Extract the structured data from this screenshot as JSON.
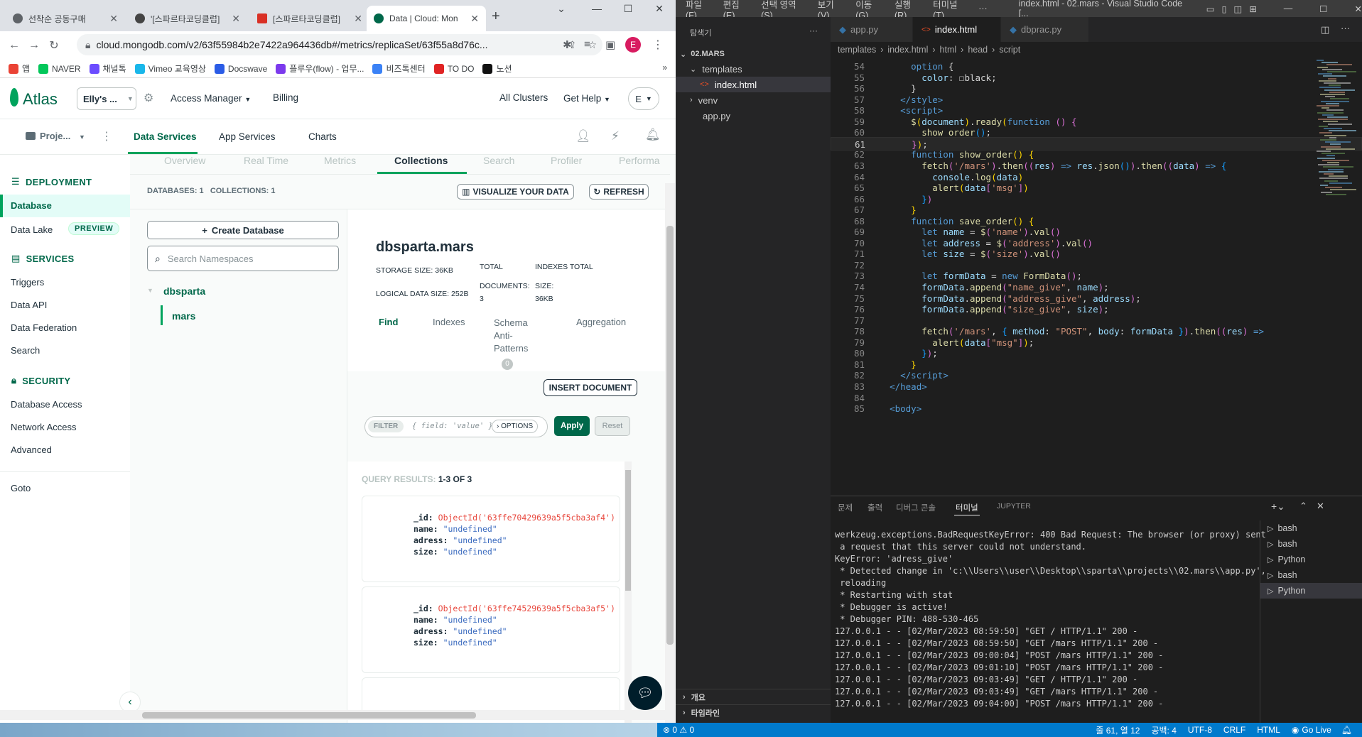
{
  "chrome": {
    "tabs": [
      {
        "title": "선착순 공동구매",
        "icon_color": "#5f6368"
      },
      {
        "title": "'[스파르타코딩클럽]",
        "icon_color": "#444444"
      },
      {
        "title": "[스파르타코딩클럽]",
        "icon_color": "#d93025"
      },
      {
        "title": "Data | Cloud: Mon",
        "icon_color": "#00684a"
      }
    ],
    "new_tab": "+",
    "window_controls": [
      "⌄",
      "—",
      "☐",
      "✕"
    ],
    "url": "cloud.mongodb.com/v2/63f55984b2e7422a964436db#/metrics/replicaSet/63f55a8d76c...",
    "profile_initial": "E",
    "bookmarks": [
      {
        "label": "앱",
        "color": "#ea4335"
      },
      {
        "label": "NAVER",
        "color": "#03c75a"
      },
      {
        "label": "채널톡",
        "color": "#6c4cff"
      },
      {
        "label": "Vimeo 교육영상",
        "color": "#1ab7ea"
      },
      {
        "label": "Docswave",
        "color": "#2b5ce6"
      },
      {
        "label": "플루우(flow) - 업무...",
        "color": "#7c3aed"
      },
      {
        "label": "비즈톡센터",
        "color": "#3b82f6"
      },
      {
        "label": "TO DO",
        "color": "#e02424"
      },
      {
        "label": "노션",
        "color": "#111111"
      }
    ],
    "bookmarks_more": "»"
  },
  "atlas": {
    "logo": "Atlas",
    "org": "Elly's ...",
    "access_manager": "Access Manager",
    "billing": "Billing",
    "all_clusters": "All Clusters",
    "get_help": "Get Help",
    "user_initial": "E",
    "project": "Proje...",
    "nav": [
      "Data Services",
      "App Services",
      "Charts"
    ],
    "subtabs": [
      "Overview",
      "Real Time",
      "Metrics",
      "Collections",
      "Search",
      "Profiler",
      "Performa"
    ],
    "sidebar": {
      "deployment_header": "DEPLOYMENT",
      "database": "Database",
      "data_lake": "Data Lake",
      "preview_badge": "PREVIEW",
      "services_header": "SERVICES",
      "services": [
        "Triggers",
        "Data API",
        "Data Federation",
        "Search"
      ],
      "security_header": "SECURITY",
      "security": [
        "Database Access",
        "Network Access",
        "Advanced"
      ],
      "goto": "Goto"
    },
    "counts": "DATABASES: 1   COLLECTIONS: 1",
    "visualize_btn": "VISUALIZE YOUR DATA",
    "refresh_btn": "REFRESH",
    "create_db_btn": "Create Database",
    "search_placeholder": "Search Namespaces",
    "db_name": "dbsparta",
    "coll_name": "mars",
    "namespace_title": "dbsparta.mars",
    "storage_size": "STORAGE SIZE: 36KB",
    "logical_size": "LOGICAL DATA SIZE: 252B",
    "total_docs_label1": "TOTAL",
    "total_docs_label2": "DOCUMENTS:",
    "total_docs_value": "3",
    "indexes_label1": "INDEXES TOTAL",
    "indexes_label2": "SIZE:",
    "indexes_value": "36KB",
    "coll_tabs": [
      "Find",
      "Indexes",
      "Schema",
      "Anti-",
      "Patterns",
      "Aggregation"
    ],
    "schema_badge": "0",
    "insert_btn": "INSERT DOCUMENT",
    "filter_label": "FILTER",
    "filter_placeholder": "{ field: 'value' }",
    "options_btn": "› OPTIONS",
    "apply_btn": "Apply",
    "reset_btn": "Reset",
    "query_results_label": "QUERY RESULTS:",
    "query_results_value": "1-3 OF 3",
    "documents": [
      {
        "id_key": "_id:",
        "id": "ObjectId('63ffe70429639a5f5cba3af4')",
        "name_key": "name:",
        "name": "\"undefined\"",
        "adress_key": "adress:",
        "adress": "\"undefined\"",
        "size_key": "size:",
        "size": "\"undefined\""
      },
      {
        "id_key": "_id:",
        "id": "ObjectId('63ffe74529639a5f5cba3af5')",
        "name_key": "name:",
        "name": "\"undefined\"",
        "adress_key": "adress:",
        "adress": "\"undefined\"",
        "size_key": "size:",
        "size": "\"undefined\""
      }
    ]
  },
  "vscode": {
    "menu": [
      "파일(F)",
      "편집(E)",
      "선택 영역(S)",
      "보기(V)",
      "이동(G)",
      "실행(R)",
      "터미널(T)",
      "···"
    ],
    "title": "index.html - 02.mars - Visual Studio Code [...",
    "explorer_header": "탐색기",
    "explorer_more": "···",
    "root": "02.MARS",
    "tree": [
      "templates",
      "index.html",
      "venv",
      "app.py"
    ],
    "outline": "개요",
    "timeline": "타임라인",
    "tabs": [
      "app.py",
      "index.html",
      "dbprac.py"
    ],
    "breadcrumbs": [
      "templates",
      "›",
      "index.html",
      "›",
      "html",
      "›",
      "head",
      "›",
      "script"
    ],
    "current_line": 61,
    "code_lines": [
      {
        "n": 54,
        "html": "      <span class='tg'>option</span> <span class='pl'>{</span>"
      },
      {
        "n": 55,
        "html": "        <span class='vr'>color</span><span class='pl'>: </span><span class='pl'>☐black;</span>"
      },
      {
        "n": 56,
        "html": "      <span class='pl'>}</span>"
      },
      {
        "n": 57,
        "html": "    <span class='tg'>&lt;/style&gt;</span>"
      },
      {
        "n": 58,
        "html": "    <span class='tg'>&lt;script&gt;</span>"
      },
      {
        "n": 59,
        "html": "      <span class='fn'>$</span><span class='br'>(</span><span class='vr'>document</span><span class='br'>)</span>.<span class='fn'>ready</span><span class='br'>(</span><span class='kw'>function</span> <span class='br2'>()</span> <span class='br2'>{</span>"
      },
      {
        "n": 60,
        "html": "        <span class='fn'>show_order</span><span class='br3'>()</span>;"
      },
      {
        "n": 61,
        "html": "      <span class='br2'>}</span><span class='br'>)</span>;"
      },
      {
        "n": 62,
        "html": "      <span class='kw'>function</span> <span class='fn'>show_order</span><span class='br'>()</span> <span class='br'>{</span>"
      },
      {
        "n": 63,
        "html": "        <span class='fn'>fetch</span><span class='br2'>(</span><span class='st'>'/mars'</span><span class='br2'>)</span>.<span class='fn'>then</span><span class='br2'>((</span><span class='vr'>res</span><span class='br2'>)</span> <span class='kw'>=&gt;</span> <span class='vr'>res</span>.<span class='fn'>json</span><span class='br3'>()</span><span class='br2'>)</span>.<span class='fn'>then</span><span class='br2'>((</span><span class='vr'>data</span><span class='br2'>)</span> <span class='kw'>=&gt;</span> <span class='br3'>{</span>"
      },
      {
        "n": 64,
        "html": "          <span class='vr'>console</span>.<span class='fn'>log</span><span class='br'>(</span><span class='vr'>data</span><span class='br'>)</span>"
      },
      {
        "n": 65,
        "html": "          <span class='fn'>alert</span><span class='br'>(</span><span class='vr'>data</span><span class='br2'>[</span><span class='st'>'msg'</span><span class='br2'>]</span><span class='br'>)</span>"
      },
      {
        "n": 66,
        "html": "        <span class='br3'>}</span><span class='br2'>)</span>"
      },
      {
        "n": 67,
        "html": "      <span class='br'>}</span>"
      },
      {
        "n": 68,
        "html": "      <span class='kw'>function</span> <span class='fn'>save_order</span><span class='br'>()</span> <span class='br'>{</span>"
      },
      {
        "n": 69,
        "html": "        <span class='kw'>let</span> <span class='vr'>name</span> = <span class='fn'>$</span><span class='br2'>(</span><span class='st'>'name'</span><span class='br2'>)</span>.<span class='fn'>val</span><span class='br2'>()</span>"
      },
      {
        "n": 70,
        "html": "        <span class='kw'>let</span> <span class='vr'>address</span> = <span class='fn'>$</span><span class='br2'>(</span><span class='st'>'address'</span><span class='br2'>)</span>.<span class='fn'>val</span><span class='br2'>()</span>"
      },
      {
        "n": 71,
        "html": "        <span class='kw'>let</span> <span class='vr'>size</span> = <span class='fn'>$</span><span class='br2'>(</span><span class='st'>'size'</span><span class='br2'>)</span>.<span class='fn'>val</span><span class='br2'>()</span>"
      },
      {
        "n": 72,
        "html": ""
      },
      {
        "n": 73,
        "html": "        <span class='kw'>let</span> <span class='vr'>formData</span> = <span class='kw'>new</span> <span class='fn'>FormData</span><span class='br2'>()</span>;"
      },
      {
        "n": 74,
        "html": "        <span class='vr'>formData</span>.<span class='fn'>append</span><span class='br2'>(</span><span class='st'>\"name_give\"</span>, <span class='vr'>name</span><span class='br2'>)</span>;"
      },
      {
        "n": 75,
        "html": "        <span class='vr'>formData</span>.<span class='fn'>append</span><span class='br2'>(</span><span class='st'>\"address_give\"</span>, <span class='vr'>address</span><span class='br2'>)</span>;"
      },
      {
        "n": 76,
        "html": "        <span class='vr'>formData</span>.<span class='fn'>append</span><span class='br2'>(</span><span class='st'>\"size_give\"</span>, <span class='vr'>size</span><span class='br2'>)</span>;"
      },
      {
        "n": 77,
        "html": ""
      },
      {
        "n": 78,
        "html": "        <span class='fn'>fetch</span><span class='br2'>(</span><span class='st'>'/mars'</span>, <span class='br3'>{</span> <span class='vr'>method</span>: <span class='st'>\"POST\"</span>, <span class='vr'>body</span>: <span class='vr'>formData</span> <span class='br3'>}</span><span class='br2'>)</span>.<span class='fn'>then</span><span class='br2'>((</span><span class='vr'>res</span><span class='br2'>)</span> <span class='kw'>=&gt;</span>"
      },
      {
        "n": 79,
        "html": "          <span class='fn'>alert</span><span class='br'>(</span><span class='vr'>data</span><span class='br2'>[</span><span class='st'>\"msg\"</span><span class='br2'>]</span><span class='br'>)</span>;"
      },
      {
        "n": 80,
        "html": "        <span class='br3'>}</span><span class='br2'>)</span>;"
      },
      {
        "n": 81,
        "html": "      <span class='br'>}</span>"
      },
      {
        "n": 82,
        "html": "    <span class='tg'>&lt;/script&gt;</span>"
      },
      {
        "n": 83,
        "html": "  <span class='tg'>&lt;/head&gt;</span>"
      },
      {
        "n": 84,
        "html": ""
      },
      {
        "n": 85,
        "html": "  <span class='tg'>&lt;body&gt;</span>"
      }
    ],
    "panel_tabs": [
      "문제",
      "출력",
      "디버그 콘솔",
      "터미널",
      "JUPYTER"
    ],
    "terminal_lines": [
      "werkzeug.exceptions.BadRequestKeyError: 400 Bad Request: The browser (or proxy) sent",
      " a request that this server could not understand.",
      "KeyError: 'adress_give'",
      " * Detected change in 'c:\\\\Users\\\\user\\\\Desktop\\\\sparta\\\\projects\\\\02.mars\\\\app.py',",
      " reloading",
      " * Restarting with stat",
      " * Debugger is active!",
      " * Debugger PIN: 488-530-465",
      "127.0.0.1 - - [02/Mar/2023 08:59:50] \"GET / HTTP/1.1\" 200 -",
      "127.0.0.1 - - [02/Mar/2023 08:59:50] \"GET /mars HTTP/1.1\" 200 -",
      "127.0.0.1 - - [02/Mar/2023 09:00:04] \"POST /mars HTTP/1.1\" 200 -",
      "127.0.0.1 - - [02/Mar/2023 09:01:10] \"POST /mars HTTP/1.1\" 200 -",
      "127.0.0.1 - - [02/Mar/2023 09:03:49] \"GET / HTTP/1.1\" 200 -",
      "127.0.0.1 - - [02/Mar/2023 09:03:49] \"GET /mars HTTP/1.1\" 200 -",
      "127.0.0.1 - - [02/Mar/2023 09:04:00] \"POST /mars HTTP/1.1\" 200 -"
    ],
    "shells": [
      "bash",
      "bash",
      "Python",
      "bash",
      "Python"
    ],
    "status": {
      "errors": "⊗ 0 ⚠ 0",
      "position": "줄 61, 열 12",
      "spaces": "공백: 4",
      "encoding": "UTF-8",
      "eol": "CRLF",
      "language": "HTML",
      "golive": "Go Live"
    }
  }
}
